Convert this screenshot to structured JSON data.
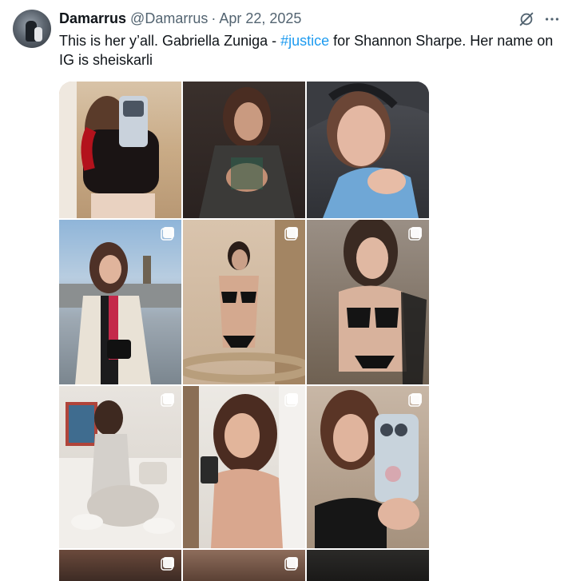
{
  "tweet": {
    "author_name": "Damarrus",
    "author_handle": "@Damarrus",
    "separator": "·",
    "date": "Apr 22, 2025",
    "text_before": "This is her y’all. Gabriella Zuniga - ",
    "hashtag": "#justice",
    "text_after": " for Shannon Sharpe. Her name on IG is sheiskarli"
  },
  "icons": {
    "grok": "grok-icon",
    "more": "more-dots-icon",
    "multi_photo": "multiple-photos-icon"
  },
  "colors": {
    "text": "#0f1419",
    "secondary": "#536471",
    "link": "#1d9bf0"
  },
  "media": {
    "columns": 3,
    "visible_rows": 4,
    "tiles": [
      {
        "name": "mirror-selfie-red-top",
        "multi": false
      },
      {
        "name": "dark-jacket-portrait",
        "multi": false
      },
      {
        "name": "car-headphones-selfie",
        "multi": false
      },
      {
        "name": "london-coat-photo",
        "multi": true
      },
      {
        "name": "black-bikini-mirror",
        "multi": true
      },
      {
        "name": "crochet-outfit-photo",
        "multi": true
      },
      {
        "name": "white-couch-photo",
        "multi": true
      },
      {
        "name": "coffee-cup-portrait",
        "multi": true
      },
      {
        "name": "phone-case-selfie",
        "multi": true
      },
      {
        "name": "partial-row-left",
        "multi": true
      },
      {
        "name": "partial-row-middle",
        "multi": true
      },
      {
        "name": "partial-row-right",
        "multi": false
      }
    ]
  }
}
